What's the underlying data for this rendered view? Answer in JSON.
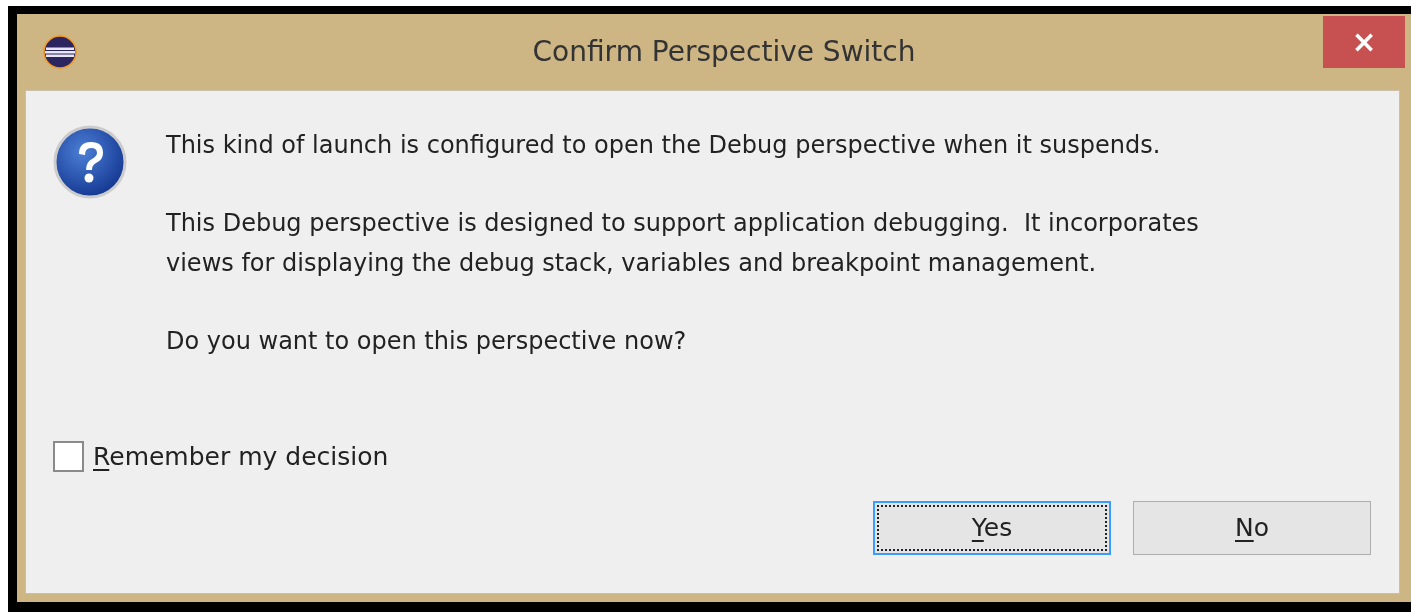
{
  "window": {
    "title": "Confirm Perspective Switch",
    "close": "×"
  },
  "message": {
    "lines": [
      {
        "text": "This kind of launch is configured to open the Debug perspective when it suspends."
      },
      {
        "text": "This Debug perspective is designed to support application debugging.  It incorporates views for displaying the debug stack, variables and breakpoint management."
      },
      {
        "text": "Do you want to open this perspective now?"
      }
    ]
  },
  "checkbox": {
    "label": "Remember my decision",
    "checked": false,
    "mnemonic_underlined": true
  },
  "buttons": [
    {
      "label": "Yes",
      "focused": true,
      "mnemonic_underlined": true
    },
    {
      "label": "No",
      "focused": false,
      "mnemonic_underlined": true
    }
  ]
}
